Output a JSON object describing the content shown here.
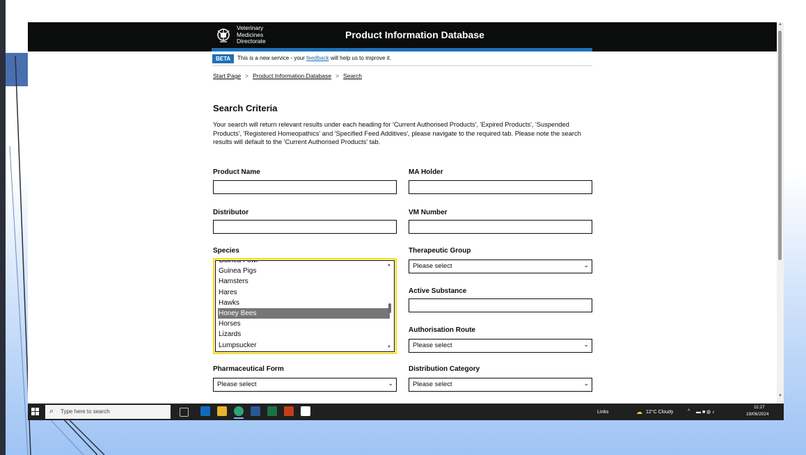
{
  "header": {
    "org_line1": "Veterinary",
    "org_line2": "Medicines",
    "org_line3": "Directorate",
    "title": "Product Information Database"
  },
  "beta": {
    "tag": "BETA",
    "text_before": "This is a new service - your ",
    "link": "feedback",
    "text_after": " will help us to improve it."
  },
  "breadcrumbs": [
    "Start Page",
    "Product Information Database",
    "Search"
  ],
  "breadcrumb_separator": ">",
  "search": {
    "heading": "Search Criteria",
    "intro": "Your search will return relevant results under each heading for 'Current Authorised Products', 'Expired Products', 'Suspended Products', 'Registered Homeopathics' and 'Specified Feed Additives', please navigate to the required tab. Please note the search results will default to the 'Current Authorised Products' tab."
  },
  "fields": {
    "product_name": {
      "label": "Product Name",
      "value": ""
    },
    "ma_holder": {
      "label": "MA Holder",
      "value": ""
    },
    "distributor": {
      "label": "Distributor",
      "value": ""
    },
    "vm_number": {
      "label": "VM Number",
      "value": ""
    },
    "species": {
      "label": "Species",
      "options": [
        "Guinea Fowl",
        "Guinea Pigs",
        "Hamsters",
        "Hares",
        "Hawks",
        "Honey Bees",
        "Horses",
        "Lizards",
        "Lumpsucker"
      ],
      "selected": "Honey Bees"
    },
    "therapeutic_group": {
      "label": "Therapeutic Group",
      "value": "Please select"
    },
    "active_substance": {
      "label": "Active Substance",
      "value": ""
    },
    "authorisation_route": {
      "label": "Authorisation Route",
      "value": "Please select"
    },
    "pharmaceutical_form": {
      "label": "Pharmaceutical Form",
      "value": "Please select"
    },
    "distribution_category": {
      "label": "Distribution Category",
      "value": "Please select"
    }
  },
  "taskbar": {
    "search_placeholder": "Type here to search",
    "links_label": "Links",
    "weather": "12°C  Cloudy",
    "time": "11:27",
    "date": "19/06/2024"
  },
  "colors": {
    "header_bg": "#0b0c0c",
    "accent_blue": "#1d70b8",
    "focus_yellow": "#ffdd00",
    "selected_option": "#767676"
  }
}
